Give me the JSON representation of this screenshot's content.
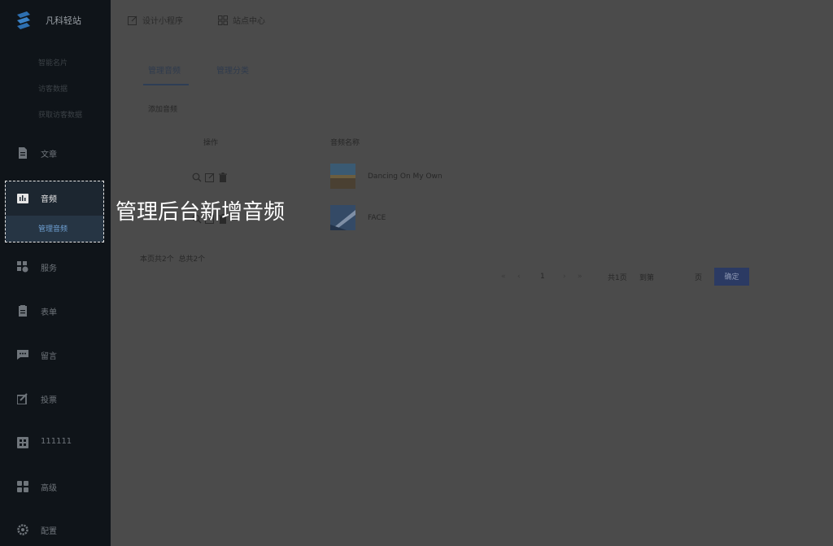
{
  "sidebar": {
    "brand": "凡科轻站",
    "faded_items": [
      "智能名片",
      "访客数据",
      "获取访客数据"
    ],
    "items": [
      {
        "label": "文章",
        "icon": "document-icon"
      },
      {
        "label": "服务",
        "icon": "service-icon"
      },
      {
        "label": "表单",
        "icon": "form-icon"
      },
      {
        "label": "留言",
        "icon": "message-icon"
      },
      {
        "label": "投票",
        "icon": "vote-icon"
      },
      {
        "label": "111111",
        "icon": "grid-icon"
      },
      {
        "label": "高级",
        "icon": "apps-icon"
      },
      {
        "label": "配置",
        "icon": "settings-icon"
      }
    ],
    "audio": {
      "label": "音频",
      "sub_label": "管理音频",
      "icon": "audio-icon"
    }
  },
  "caption": "管理后台新增音频",
  "topbar": {
    "design": "设计小程序",
    "site_center": "站点中心"
  },
  "tabs": [
    "管理音频",
    "管理分类"
  ],
  "add_audio": "添加音频",
  "table": {
    "headers": {
      "action": "操作",
      "name": "音频名称"
    },
    "rows": [
      {
        "name": "Dancing On My Own"
      },
      {
        "name": "FACE"
      }
    ]
  },
  "summary": "本页共2个  总共2个",
  "pagination": {
    "current_page": "1",
    "total_pages": "共1页",
    "goto": "到第",
    "page_unit": "页",
    "confirm": "确定"
  },
  "colors": {
    "sidebar": "#0f1419",
    "overlay": "#4b4b4b",
    "accent": "#2b3a63"
  }
}
